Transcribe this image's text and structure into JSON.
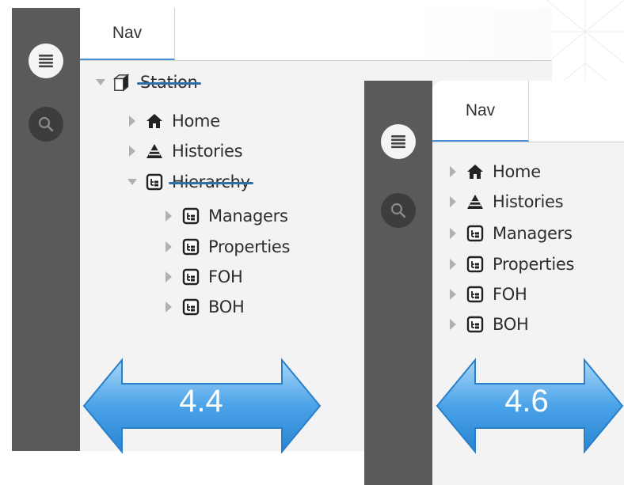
{
  "version_left": {
    "tab_label": "Nav",
    "tree": {
      "root": "Station",
      "items": [
        {
          "label": "Home",
          "icon": "home-icon"
        },
        {
          "label": "Histories",
          "icon": "histories-icon"
        },
        {
          "label": "Hierarchy",
          "icon": "hierarchy-icon",
          "children": [
            "Managers",
            "Properties",
            "FOH",
            "BOH"
          ]
        }
      ]
    },
    "version_badge": "4.4"
  },
  "version_right": {
    "tab_label": "Nav",
    "tree": {
      "items": [
        {
          "label": "Home",
          "icon": "home-icon"
        },
        {
          "label": "Histories",
          "icon": "histories-icon"
        },
        {
          "label": "Managers",
          "icon": "hierarchy-icon"
        },
        {
          "label": "Properties",
          "icon": "hierarchy-icon"
        },
        {
          "label": "FOH",
          "icon": "hierarchy-icon"
        },
        {
          "label": "BOH",
          "icon": "hierarchy-icon"
        }
      ]
    },
    "version_badge": "4.6"
  },
  "colors": {
    "rail": "#5a5a5a",
    "content_bg": "#f3f3f3",
    "strike": "#2f6fa7",
    "arrow_fill": "#4aa3e8",
    "tab_underline": "#4a90d9"
  }
}
